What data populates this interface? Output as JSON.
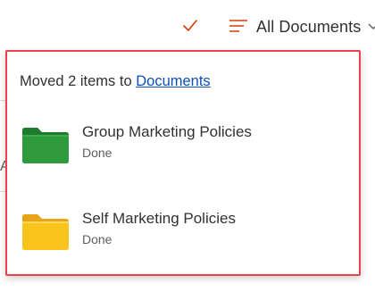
{
  "toolbar": {
    "view_label": "All Documents",
    "icons": {
      "check": "checkmark-icon",
      "view": "lines-icon",
      "chevron": "chevron-down-icon"
    },
    "accent_color": "#d83b01"
  },
  "left_edge": {
    "partial_letter": "A"
  },
  "notification": {
    "message_prefix": "Moved 2 items to ",
    "link_text": "Documents",
    "highlight_color": "#e8434b",
    "link_color": "#0f4fb5",
    "items": [
      {
        "name": "Group Marketing Policies",
        "status": "Done",
        "icon": "green-folder-icon",
        "color": "#2e8b3a"
      },
      {
        "name": "Self Marketing Policies",
        "status": "Done",
        "icon": "yellow-folder-icon",
        "color": "#f5c518"
      }
    ]
  }
}
